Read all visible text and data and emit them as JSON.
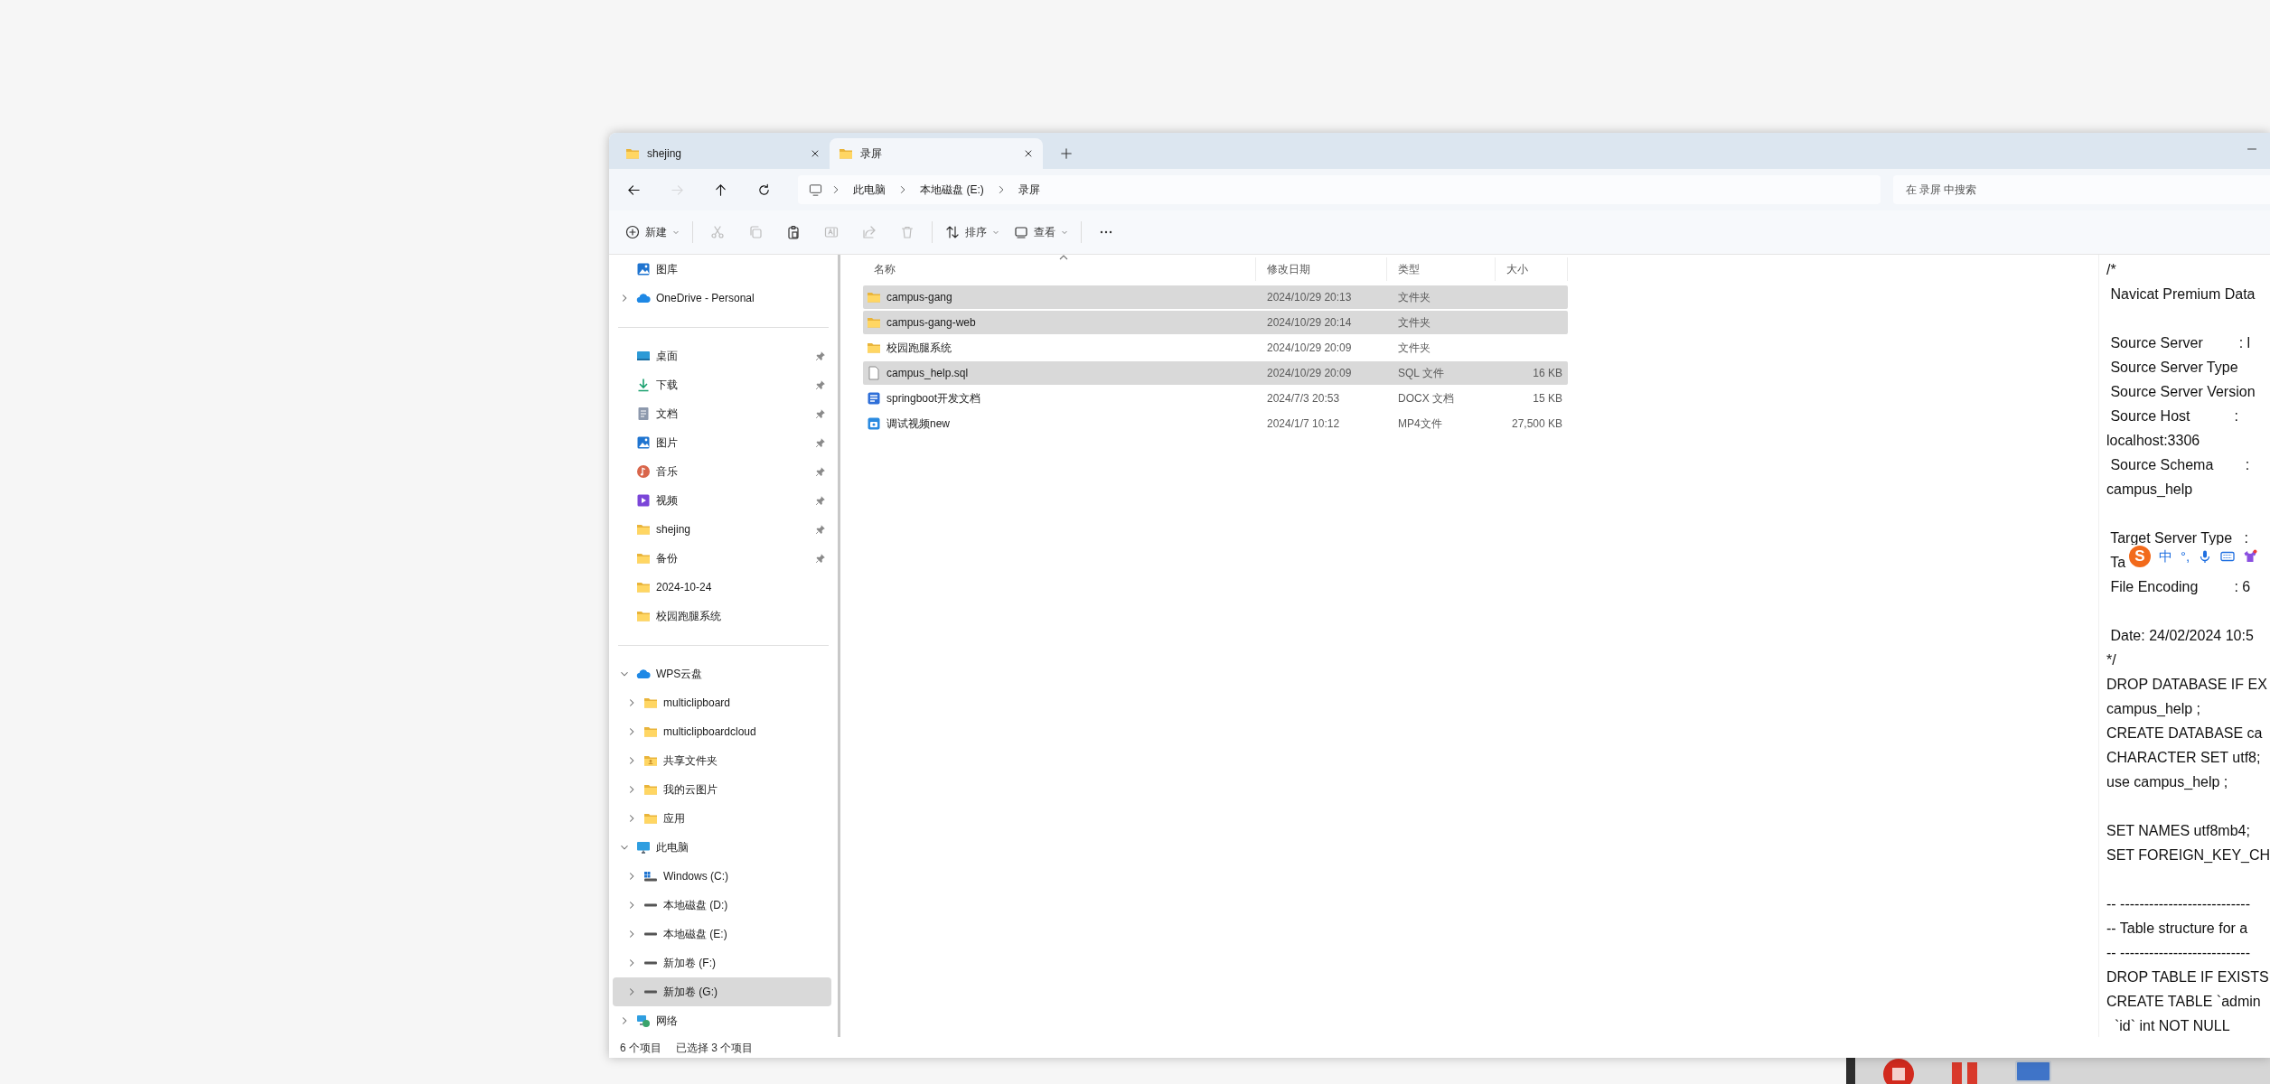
{
  "window": {
    "tabs": [
      {
        "label": "shejing",
        "selected": false
      },
      {
        "label": "录屏",
        "selected": true
      }
    ]
  },
  "nav": {
    "buttons": [
      {
        "kind": "back",
        "disabled": false
      },
      {
        "kind": "forward",
        "disabled": true
      },
      {
        "kind": "up",
        "disabled": false
      },
      {
        "kind": "refresh",
        "disabled": false
      }
    ],
    "breadcrumb": [
      "此电脑",
      "本地磁盘 (E:)",
      "录屏"
    ],
    "search": {
      "placeholder": "在 录屏 中搜索"
    }
  },
  "toolbar": [
    [
      {
        "kind": "new",
        "label": "新建",
        "disabled": false
      }
    ],
    [
      {
        "kind": "cut",
        "disabled": true
      },
      {
        "kind": "copy",
        "disabled": true
      },
      {
        "kind": "paste",
        "disabled": false
      },
      {
        "kind": "rename",
        "disabled": true
      },
      {
        "kind": "share",
        "disabled": true
      },
      {
        "kind": "delete",
        "disabled": true
      }
    ],
    [
      {
        "kind": "sort",
        "label": "排序",
        "disabled": false
      },
      {
        "kind": "view",
        "label": "查看",
        "disabled": false
      }
    ],
    [
      {
        "kind": "more",
        "disabled": false
      }
    ]
  ],
  "sidebar": {
    "sections": [
      [
        {
          "label": "图库",
          "kind": "gallery",
          "selected": false
        },
        {
          "label": "OneDrive - Personal",
          "kind": "cloud",
          "expanded": false,
          "selected": false
        }
      ],
      [
        {
          "label": "桌面",
          "kind": "desktop",
          "pinned": true,
          "selected": false
        },
        {
          "label": "下载",
          "kind": "download",
          "pinned": true,
          "selected": false
        },
        {
          "label": "文档",
          "kind": "document",
          "pinned": true,
          "selected": false
        },
        {
          "label": "图片",
          "kind": "picture",
          "pinned": true,
          "selected": false
        },
        {
          "label": "音乐",
          "kind": "music",
          "pinned": true,
          "selected": false
        },
        {
          "label": "视频",
          "kind": "video",
          "pinned": true,
          "selected": false
        },
        {
          "label": "shejing",
          "kind": "folder",
          "pinned": true,
          "selected": false
        },
        {
          "label": "备份",
          "kind": "folder",
          "pinned": true,
          "selected": false
        },
        {
          "label": "2024-10-24",
          "kind": "folder",
          "pinned": false,
          "selected": false
        },
        {
          "label": "校园跑腿系统",
          "kind": "folder",
          "pinned": false,
          "selected": false
        }
      ],
      [
        {
          "label": "WPS云盘",
          "kind": "cloud",
          "expanded": true,
          "selected": false,
          "children": [
            {
              "label": "multiclipboard",
              "kind": "folder",
              "expanded": false,
              "selected": false
            },
            {
              "label": "multiclipboardcloud",
              "kind": "folder",
              "expanded": false,
              "selected": false
            },
            {
              "label": "共享文件夹",
              "kind": "shared",
              "expanded": false,
              "selected": false
            },
            {
              "label": "我的云图片",
              "kind": "folder",
              "expanded": false,
              "selected": false
            },
            {
              "label": "应用",
              "kind": "folder",
              "expanded": false,
              "selected": false
            }
          ]
        },
        {
          "label": "此电脑",
          "kind": "pc",
          "expanded": true,
          "selected": false,
          "children": [
            {
              "label": "Windows (C:)",
              "kind": "windrive",
              "expanded": false,
              "selected": false
            },
            {
              "label": "本地磁盘 (D:)",
              "kind": "drive",
              "expanded": false,
              "selected": false
            },
            {
              "label": "本地磁盘 (E:)",
              "kind": "drive",
              "expanded": false,
              "selected": false
            },
            {
              "label": "新加卷 (F:)",
              "kind": "drive",
              "expanded": false,
              "selected": false
            },
            {
              "label": "新加卷 (G:)",
              "kind": "drive",
              "expanded": false,
              "selected": true
            }
          ]
        },
        {
          "label": "网络",
          "kind": "network",
          "expanded": false,
          "selected": false
        }
      ]
    ]
  },
  "file_list": {
    "columns": [
      {
        "label": "名称",
        "sorted": true
      },
      {
        "label": "修改日期",
        "sorted": false
      },
      {
        "label": "类型",
        "sorted": false
      },
      {
        "label": "大小",
        "sorted": false
      }
    ],
    "rows": [
      {
        "name": "campus-gang",
        "date": "2024/10/29 20:13",
        "type": "文件夹",
        "kind": "folder",
        "selected": true
      },
      {
        "name": "campus-gang-web",
        "date": "2024/10/29 20:14",
        "type": "文件夹",
        "kind": "folder",
        "selected": true
      },
      {
        "name": "校园跑腿系统",
        "date": "2024/10/29 20:09",
        "type": "文件夹",
        "kind": "folder",
        "selected": false
      },
      {
        "name": "campus_help.sql",
        "date": "2024/10/29 20:09",
        "type": "SQL 文件",
        "size": "16 KB",
        "kind": "file",
        "selected": true
      },
      {
        "name": "springboot开发文档",
        "date": "2024/7/3 20:53",
        "type": "DOCX 文档",
        "size": "15 KB",
        "kind": "word",
        "selected": false
      },
      {
        "name": "调试视频new",
        "date": "2024/1/7 10:12",
        "type": "MP4文件",
        "size": "27,500 KB",
        "kind": "video",
        "selected": false
      }
    ]
  },
  "preview": {
    "blocks": [
      [
        "/*",
        " Navicat Premium Data"
      ],
      [
        " Source Server         : l",
        " Source Server Type",
        " Source Server Version",
        " Source Host           :",
        "localhost:3306",
        " Source Schema        :",
        "campus_help"
      ],
      [
        " Target Server Type   :",
        " Ta",
        " File Encoding         : 6"
      ],
      [
        " Date: 24/02/2024 10:5",
        "*/",
        "DROP DATABASE IF EX",
        "campus_help ;",
        "CREATE DATABASE ca",
        "CHARACTER SET utf8;",
        "use campus_help ;"
      ],
      [
        "SET NAMES utf8mb4;",
        "SET FOREIGN_KEY_CH"
      ],
      [
        "-- ---------------------------",
        "-- Table structure for a",
        "-- ---------------------------",
        "DROP TABLE IF EXISTS",
        "CREATE TABLE `admin",
        "  `id` int NOT NULL"
      ]
    ]
  },
  "ime_toolbar": {
    "logo": "S",
    "items": [
      {
        "kind": "text",
        "text": "中"
      },
      {
        "kind": "text",
        "text": "°,"
      },
      {
        "kind": "mic"
      },
      {
        "kind": "keyboard"
      },
      {
        "kind": "skin"
      }
    ]
  },
  "status_bar": {
    "item_count": "6 个项目",
    "selection": "已选择 3 个项目"
  }
}
